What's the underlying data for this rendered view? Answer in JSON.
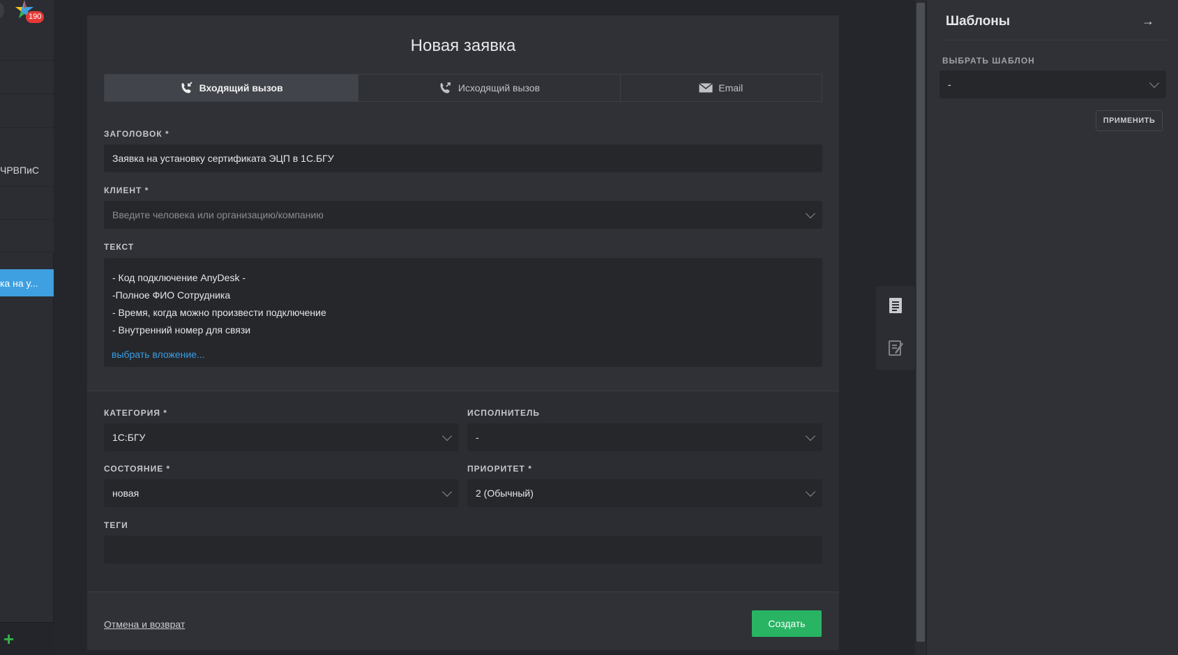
{
  "nav": {
    "badge": "190",
    "rows": [
      {
        "label": ""
      },
      {
        "label": ""
      },
      {
        "label": ""
      },
      {
        "label": ""
      },
      {
        "label": "ЧРВПиС"
      },
      {
        "label": ""
      },
      {
        "label": ""
      },
      {
        "label": "ка на у..."
      }
    ]
  },
  "dialog": {
    "title": "Новая заявка",
    "tabs": {
      "incoming": "Входящий вызов",
      "outgoing": "Исходящий вызов",
      "email": "Email"
    },
    "title_field": {
      "label": "ЗАГОЛОВОК *",
      "value": "Заявка на установку сертификата ЭЦП в 1С.БГУ"
    },
    "client_field": {
      "label": "КЛИЕНТ *",
      "placeholder": "Введите человека или организацию/компанию"
    },
    "text_field": {
      "label": "ТЕКСТ",
      "lines": [
        "- Код подключение AnyDesk -",
        "-Полное ФИО Сотрудника",
        "- Время, когда можно произвести подключение",
        "- Внутренний номер для связи"
      ],
      "attach_link": "выбрать вложение..."
    },
    "category": {
      "label": "КАТЕГОРИЯ *",
      "value": "1С:БГУ"
    },
    "assignee": {
      "label": "ИСПОЛНИТЕЛЬ",
      "value": "-"
    },
    "state": {
      "label": "СОСТОЯНИЕ *",
      "value": "новая"
    },
    "priority": {
      "label": "ПРИОРИТЕТ *",
      "value": "2 (Обычный)"
    },
    "tags": {
      "label": "ТЕГИ",
      "value": ""
    },
    "cancel_link": "Отмена и возврат",
    "create_button": "Создать"
  },
  "templates": {
    "title": "Шаблоны",
    "select_label": "ВЫБРАТЬ ШАБЛОН",
    "select_value": "-",
    "apply_button": "ПРИМЕНИТЬ"
  },
  "colors": {
    "accent": "#3ea0e0",
    "create": "#28b463",
    "badge": "#e53935",
    "link": "#3a9ee4"
  },
  "icons": {
    "incoming": "phone-incoming-icon",
    "outgoing": "phone-outgoing-icon",
    "email": "envelope-icon",
    "panel_close": "arrow-right-icon",
    "tool1": "document-icon",
    "tool2": "note-edit-icon"
  }
}
